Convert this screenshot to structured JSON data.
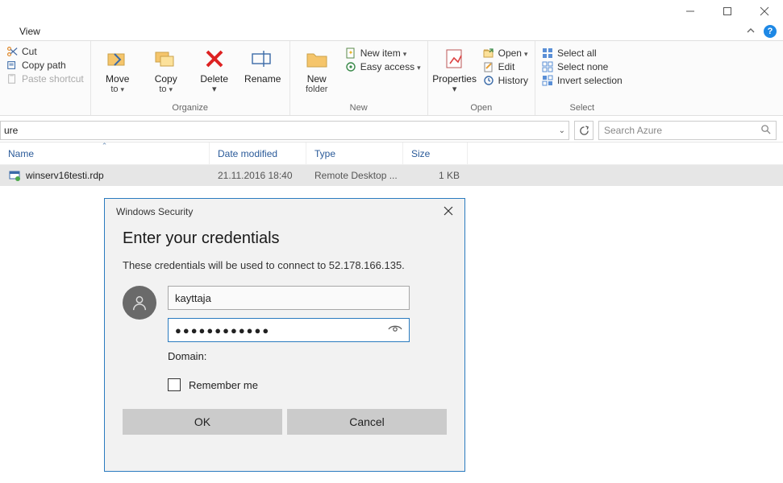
{
  "titlebar": {},
  "menu": {
    "view": "View"
  },
  "ribbon": {
    "clipboard": {
      "cut": "Cut",
      "copy_path": "Copy path",
      "paste_shortcut": "Paste shortcut"
    },
    "organize": {
      "move_to": "Move to",
      "copy_to": "Copy to",
      "delete": "Delete",
      "rename": "Rename",
      "label": "Organize",
      "to_suffix": "to"
    },
    "new": {
      "new_folder": "New folder",
      "new_item": "New item",
      "easy_access": "Easy access",
      "label": "New"
    },
    "open": {
      "properties": "Properties",
      "open": "Open",
      "edit": "Edit",
      "history": "History",
      "label": "Open"
    },
    "select": {
      "select_all": "Select all",
      "select_none": "Select none",
      "invert": "Invert selection",
      "label": "Select"
    }
  },
  "address": {
    "path_text": "ure"
  },
  "search": {
    "placeholder": "Search Azure"
  },
  "columns": {
    "name": "Name",
    "date": "Date modified",
    "type": "Type",
    "size": "Size"
  },
  "files": [
    {
      "name": "winserv16testi.rdp",
      "date": "21.11.2016 18:40",
      "type": "Remote Desktop ...",
      "size": "1 KB"
    }
  ],
  "dialog": {
    "title": "Windows Security",
    "heading": "Enter your credentials",
    "subtext": "These credentials will be used to connect to 52.178.166.135.",
    "username": "kayttaja",
    "password_mask": "●●●●●●●●●●●●",
    "domain_label": "Domain:",
    "remember": "Remember me",
    "ok": "OK",
    "cancel": "Cancel"
  }
}
